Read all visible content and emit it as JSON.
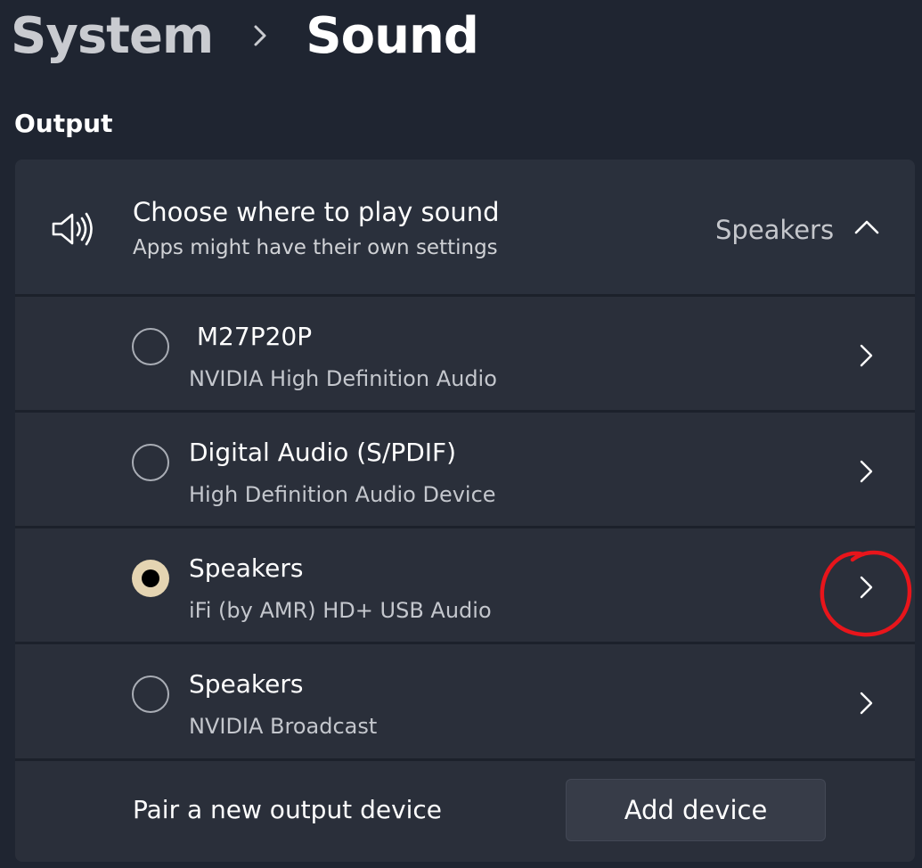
{
  "breadcrumb": {
    "parent": "System",
    "current": "Sound"
  },
  "section": {
    "label": "Output"
  },
  "output_selector": {
    "title": "Choose where to play sound",
    "subtitle": "Apps might have their own settings",
    "selected_value": "Speakers",
    "expanded": true,
    "icon": "speaker-icon"
  },
  "devices": [
    {
      "name": " M27P20P",
      "description": "NVIDIA High Definition Audio",
      "selected": false
    },
    {
      "name": "Digital Audio (S/PDIF)",
      "description": "High Definition Audio Device",
      "selected": false
    },
    {
      "name": "Speakers",
      "description": "iFi (by AMR) HD+ USB Audio",
      "selected": true
    },
    {
      "name": "Speakers",
      "description": "NVIDIA Broadcast",
      "selected": false
    }
  ],
  "footer": {
    "label": "Pair a new output device",
    "button_label": "Add device"
  },
  "colors": {
    "background": "#1f2531",
    "card": "#2a2f3a",
    "radio_selected": "#e4d4b2",
    "annotation": "#e8151b"
  }
}
